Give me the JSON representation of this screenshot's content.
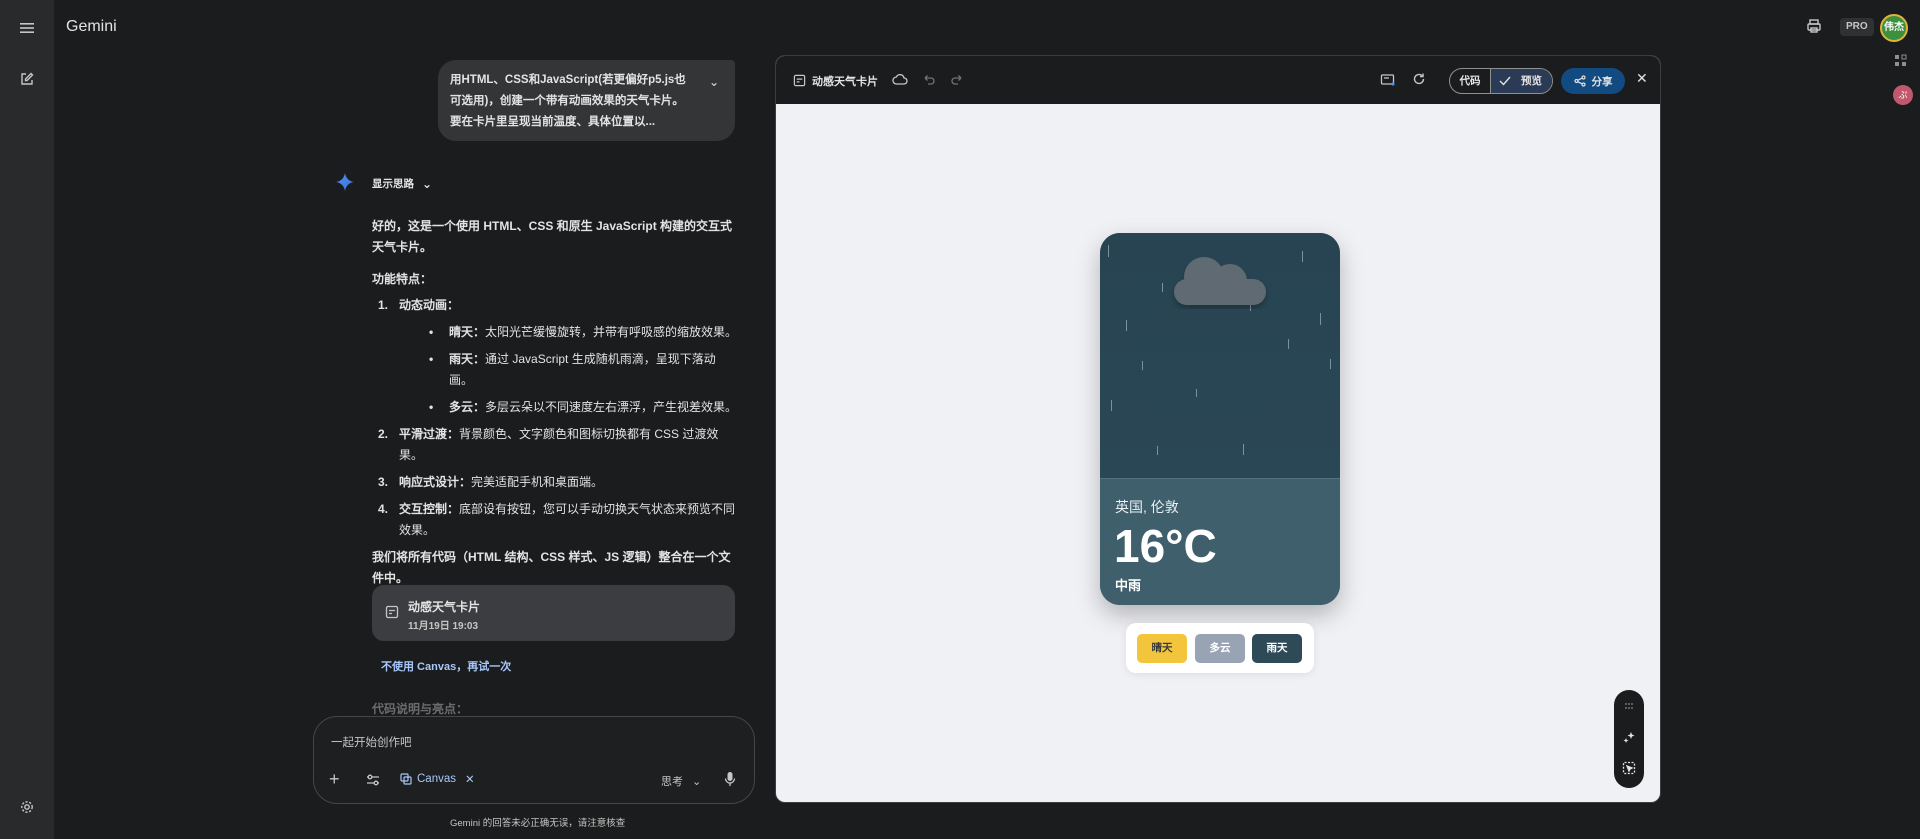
{
  "app": {
    "brand": "Gemini",
    "pro_badge": "PRO",
    "avatar_text": "伟杰",
    "ext_text": "ぷ"
  },
  "user_message": {
    "text": "用HTML、CSS和JavaScript(若更偏好p5.js也可选用)，创建一个带有动画效果的天气卡片。要在卡片里呈现当前温度、具体位置以..."
  },
  "response": {
    "show_thinking": "显示思路",
    "intro": "好的，这是一个使用 HTML、CSS 和原生 JavaScript 构建的交互式天气卡片。",
    "features_title": "功能特点：",
    "items": [
      {
        "num": "1.",
        "title": "动态动画：",
        "text": "",
        "sub": [
          {
            "title": "晴天：",
            "text": "太阳光芒缓慢旋转，并带有呼吸感的缩放效果。"
          },
          {
            "title": "雨天：",
            "text": "通过 JavaScript 生成随机雨滴，呈现下落动画。"
          },
          {
            "title": "多云：",
            "text": "多层云朵以不同速度左右漂浮，产生视差效果。"
          }
        ]
      },
      {
        "num": "2.",
        "title": "平滑过渡：",
        "text": "背景颜色、文字颜色和图标切换都有 CSS 过渡效果。",
        "sub": []
      },
      {
        "num": "3.",
        "title": "响应式设计：",
        "text": "完美适配手机和桌面端。",
        "sub": []
      },
      {
        "num": "4.",
        "title": "交互控制：",
        "text": "底部设有按钮，您可以手动切换天气状态来预览不同效果。",
        "sub": []
      }
    ],
    "merge_note": "我们将所有代码（HTML 结构、CSS 样式、JS 逻辑）整合在一个文件中。",
    "artifact": {
      "title": "动感天气卡片",
      "date": "11月19日 19:03"
    },
    "retry": "不使用 Canvas，再试一次",
    "faded": "代码说明与亮点："
  },
  "composer": {
    "placeholder": "一起开始创作吧",
    "canvas_chip": "Canvas",
    "mode": "思考",
    "disclaimer": "Gemini 的回答未必正确无误，请注意核查"
  },
  "canvas": {
    "title": "动感天气卡片",
    "code_tab": "代码",
    "preview_tab": "预览",
    "share": "分享"
  },
  "weather": {
    "location": "英国, 伦敦",
    "temperature": "16°C",
    "condition": "中雨",
    "buttons": [
      "晴天",
      "多云",
      "雨天"
    ],
    "colors": {
      "sunny": "#f2c53d",
      "cloudy": "#98a4b3",
      "rainy": "#2e4a57"
    }
  },
  "icons": [
    "menu-icon",
    "edit-icon",
    "settings-icon",
    "print-icon",
    "apps-icon",
    "spark-icon",
    "chevron-down-icon",
    "canvas-icon",
    "cloud-sync-icon",
    "undo-icon",
    "redo-icon",
    "screen-icon",
    "refresh-icon",
    "check-icon",
    "share-icon",
    "close-icon",
    "plus-icon",
    "tune-icon",
    "mic-icon",
    "cloud-icon",
    "drag-icon",
    "magic-icon",
    "select-icon"
  ]
}
